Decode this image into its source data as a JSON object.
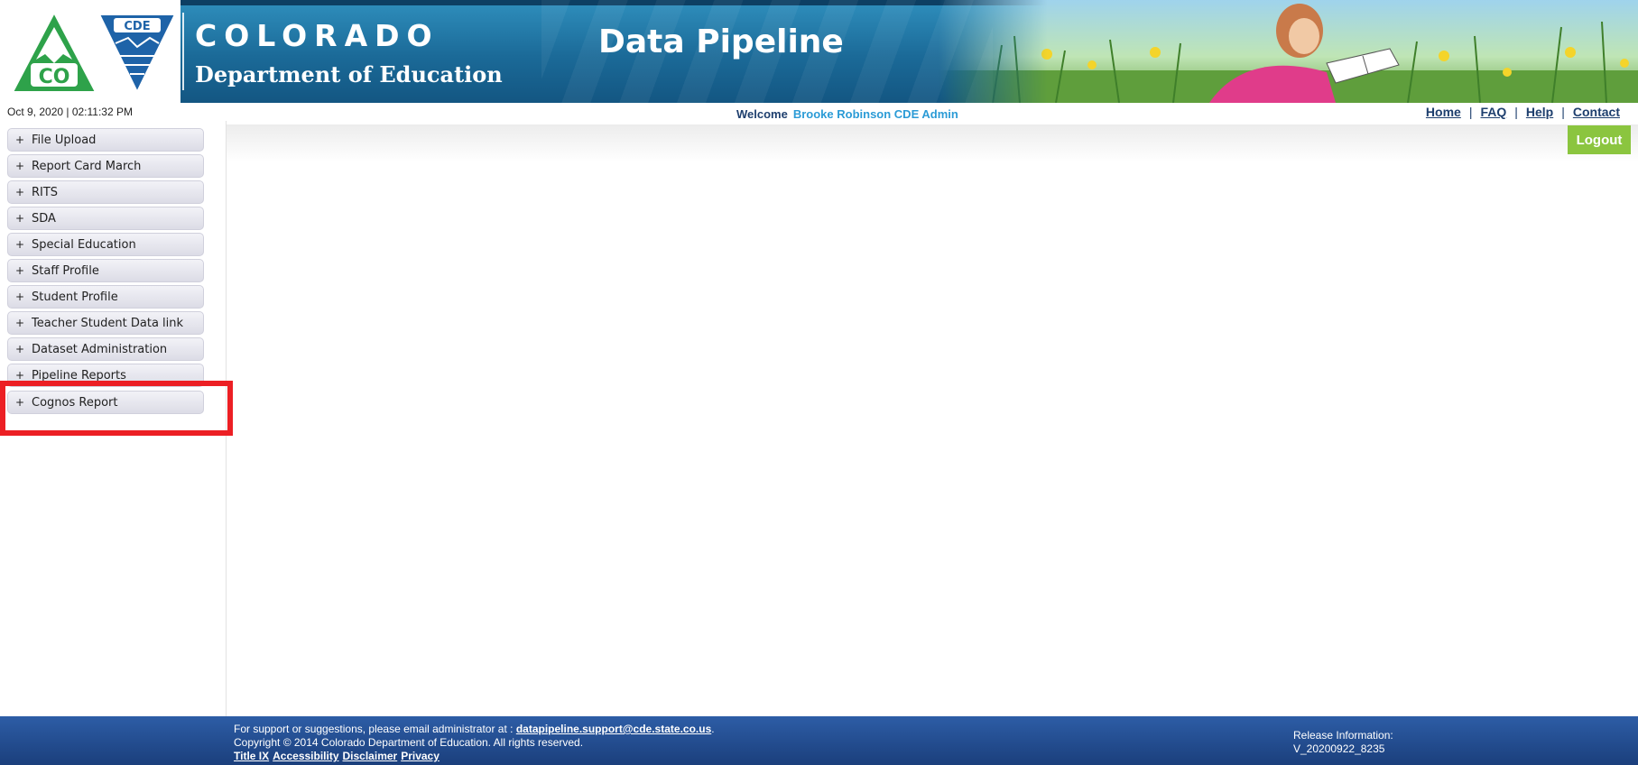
{
  "header": {
    "logo_text": "CDE",
    "logo_state": "CO",
    "org_name": "COLORADO",
    "org_sub": "Department of Education",
    "app_title": "Data Pipeline"
  },
  "topbar": {
    "datetime": "Oct 9, 2020 | 02:11:32 PM",
    "welcome_label": "Welcome",
    "welcome_name": "Brooke Robinson CDE Admin",
    "links": {
      "home": "Home",
      "faq": "FAQ",
      "help": "Help",
      "contact": "Contact",
      "separator": "|"
    },
    "logout_label": "Logout"
  },
  "sidebar": {
    "items": [
      {
        "label": "File Upload"
      },
      {
        "label": "Report Card March"
      },
      {
        "label": "RITS"
      },
      {
        "label": "SDA"
      },
      {
        "label": "Special Education"
      },
      {
        "label": "Staff Profile"
      },
      {
        "label": "Student Profile"
      },
      {
        "label": "Teacher Student Data link"
      },
      {
        "label": "Dataset Administration"
      },
      {
        "label": "Pipeline Reports"
      },
      {
        "label": "Cognos Report"
      }
    ],
    "expand_glyph": "+"
  },
  "footer": {
    "support_text": "For support or suggestions, please email administrator at :",
    "support_email": "datapipeline.support@cde.state.co.us",
    "support_period": ".",
    "copyright": "Copyright © 2014 Colorado Department of Education. All rights reserved.",
    "links": {
      "title_ix": "Title IX",
      "accessibility": "Accessibility",
      "disclaimer": "Disclaimer",
      "privacy": "Privacy"
    },
    "release_label": "Release Information:",
    "release_version": "V_20200922_8235"
  },
  "colors": {
    "banner_blue": "#1b6a98",
    "footer_blue": "#1b3f7c",
    "logout_green": "#8bc53f",
    "highlight_red": "#ec1f24",
    "welcome_name": "#2b9bd6"
  }
}
